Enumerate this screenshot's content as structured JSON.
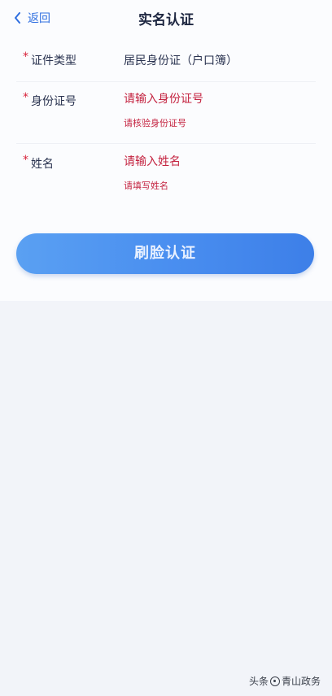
{
  "navbar": {
    "back_label": "返回",
    "title": "实名认证"
  },
  "form": {
    "required_mark": "*",
    "cert_type": {
      "label": "证件类型",
      "value": "居民身份证（户口簿）"
    },
    "id_number": {
      "label": "身份证号",
      "placeholder": "请输入身份证号",
      "error": "请核验身份证号"
    },
    "name": {
      "label": "姓名",
      "placeholder": "请输入姓名",
      "error": "请填写姓名"
    }
  },
  "actions": {
    "face_auth_label": "刷脸认证"
  },
  "watermark": {
    "prefix": "头条",
    "account": "青山政务"
  },
  "colors": {
    "accent": "#2f6fe0",
    "button": "#4a8ff0",
    "error": "#c42340",
    "page_bg": "#f2f4f9"
  }
}
